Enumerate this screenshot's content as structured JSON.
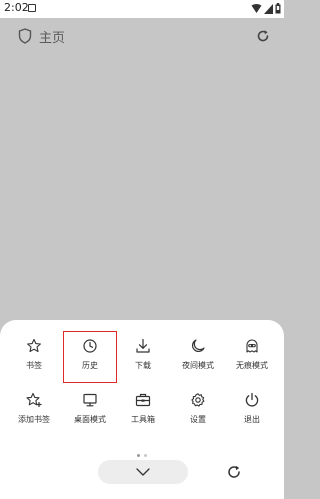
{
  "status_bar": {
    "time": "2:02"
  },
  "top_bar": {
    "home_label": "主页"
  },
  "menu": {
    "row1": [
      {
        "label": "书签",
        "icon": "star-icon"
      },
      {
        "label": "历史",
        "icon": "clock-icon",
        "selected": true
      },
      {
        "label": "下载",
        "icon": "download-icon"
      },
      {
        "label": "夜间模式",
        "icon": "moon-icon"
      },
      {
        "label": "无痕模式",
        "icon": "incognito-icon"
      }
    ],
    "row2": [
      {
        "label": "添加书签",
        "icon": "star-plus-icon"
      },
      {
        "label": "桌面模式",
        "icon": "monitor-icon"
      },
      {
        "label": "工具箱",
        "icon": "toolbox-icon"
      },
      {
        "label": "设置",
        "icon": "gear-icon"
      },
      {
        "label": "退出",
        "icon": "power-icon"
      }
    ]
  },
  "colors": {
    "highlight": "#e02a2a",
    "background": "#c6c6c6",
    "sheet": "#ffffff"
  }
}
